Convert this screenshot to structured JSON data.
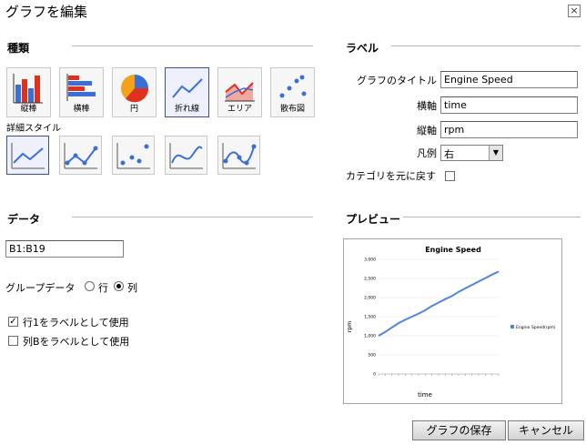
{
  "dialog": {
    "title": "グラフを編集",
    "close_label": "×"
  },
  "sections": {
    "chart_type": "種類",
    "labels": "ラベル",
    "data": "データ",
    "preview": "プレビュー"
  },
  "chart_types": [
    {
      "label": "縦棒",
      "icon": "column-chart-icon"
    },
    {
      "label": "横棒",
      "icon": "bar-chart-icon"
    },
    {
      "label": "円",
      "icon": "pie-chart-icon"
    },
    {
      "label": "折れ線",
      "icon": "line-chart-icon",
      "selected": true
    },
    {
      "label": "エリア",
      "icon": "area-chart-icon"
    },
    {
      "label": "散布図",
      "icon": "scatter-chart-icon"
    }
  ],
  "detail_style_label": "詳細スタイル",
  "detail_styles": [
    {
      "icon": "line-plain-icon",
      "selected": true
    },
    {
      "icon": "line-markers-icon"
    },
    {
      "icon": "markers-only-icon"
    },
    {
      "icon": "smooth-line-icon"
    },
    {
      "icon": "smooth-line-markers-icon"
    }
  ],
  "labels_form": {
    "chart_title_label": "グラフのタイトル",
    "chart_title_value": "Engine Speed",
    "x_axis_label": "横軸",
    "x_axis_value": "time",
    "y_axis_label": "縦軸",
    "y_axis_value": "rpm",
    "legend_label": "凡例",
    "legend_value": "右",
    "reset_categories_label": "カテゴリを元に戻す"
  },
  "data_form": {
    "range_value": "B1:B19",
    "group_label": "グループデータ",
    "row_label": "行",
    "col_label": "列",
    "group_selected": "列",
    "row1_label_text": "行1をラベルとして使用",
    "row1_checked": true,
    "colB_label_text": "列Bをラベルとして使用",
    "colB_checked": false
  },
  "chart_data": {
    "type": "line",
    "title": "Engine Speed",
    "xlabel": "time",
    "ylabel": "rpm",
    "ylim": [
      0,
      3000
    ],
    "yticks": [
      "0",
      "500",
      "1,000",
      "1,500",
      "2,000",
      "2,500",
      "3,000"
    ],
    "legend_position": "right",
    "series": [
      {
        "name": "Engine Speed(rpm)",
        "color": "#4f84e0",
        "values": [
          1000,
          1100,
          1220,
          1330,
          1420,
          1500,
          1580,
          1670,
          1780,
          1870,
          1960,
          2040,
          2150,
          2240,
          2330,
          2420,
          2510,
          2600,
          2680
        ]
      }
    ]
  },
  "buttons": {
    "save_label": "グラフの保存",
    "cancel_label": "キャンセル"
  }
}
